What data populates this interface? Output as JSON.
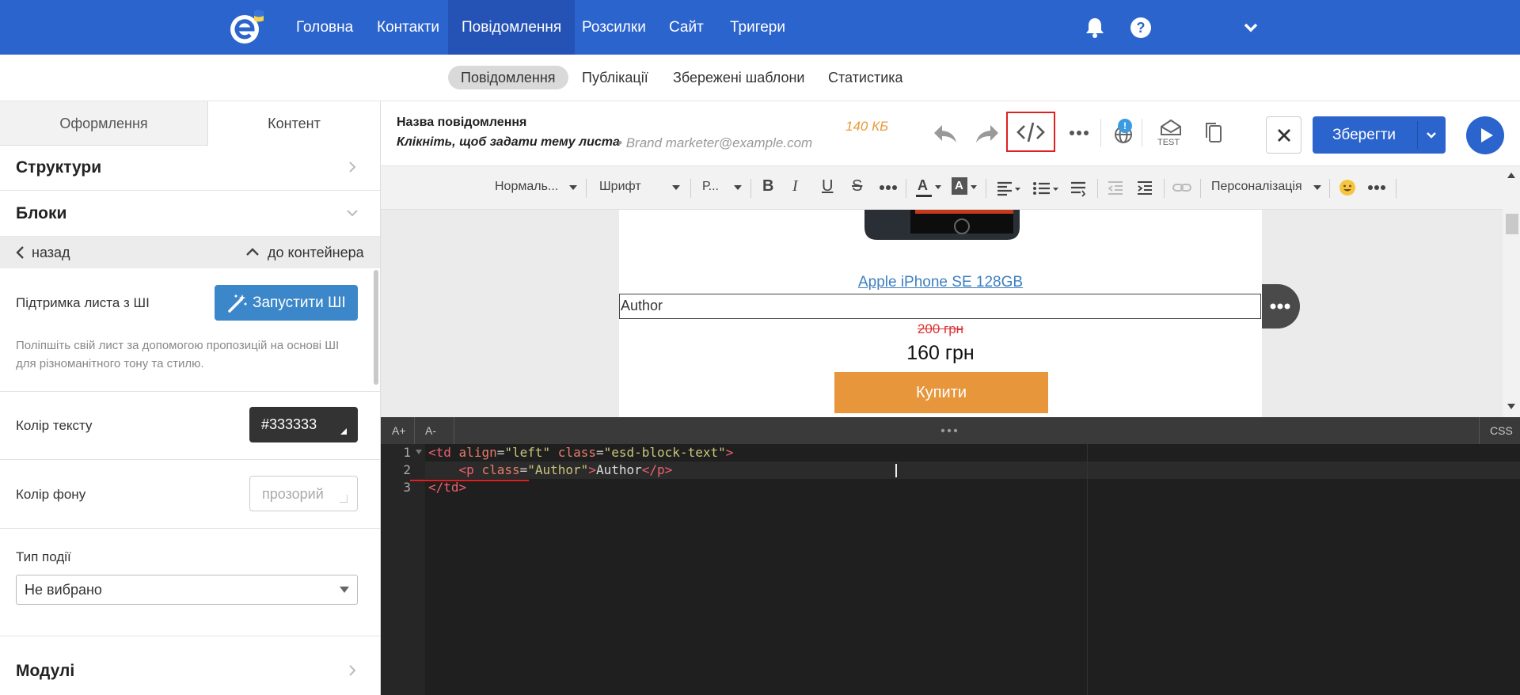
{
  "topnav": {
    "items": [
      "Головна",
      "Контакти",
      "Повідомлення",
      "Розсилки",
      "Сайт",
      "Тригери"
    ],
    "active_index": 2
  },
  "subnav": {
    "items": [
      "Повідомлення",
      "Публікації",
      "Збережені шаблони",
      "Статистика"
    ],
    "active_index": 0
  },
  "leftpanel": {
    "tabs": [
      "Оформлення",
      "Контент"
    ],
    "active_tab": 1,
    "structures_label": "Структури",
    "blocks_label": "Блоки",
    "back_label": "назад",
    "to_container_label": "до контейнера",
    "ai_support_label": "Підтримка листа з ШІ",
    "ai_button_label": "Запустити ШІ",
    "ai_description": "Поліпшіть свій лист за допомогою пропозицій на основі ШІ для різноманітного тону та стилю.",
    "text_color_label": "Колір тексту",
    "text_color_value": "#333333",
    "bg_color_label": "Колір фону",
    "bg_color_value": "прозорий",
    "event_type_label": "Тип події",
    "event_type_value": "Не вибрано",
    "modules_label": "Модулі"
  },
  "editor_header": {
    "message_name": "Назва повідомлення",
    "subject_hint": "Клікніть, щоб задати тему листа",
    "sender": "Brand marketer@example.com",
    "size": "140 КБ",
    "test_label": "TEST",
    "badge_count": "!",
    "save_label": "Зберегти"
  },
  "format_toolbar": {
    "paragraph": "Нормаль...",
    "font": "Шрифт",
    "size": "Р...",
    "personalization": "Персоналізація"
  },
  "email_preview": {
    "product_link": "Apple iPhone SE 128GB",
    "selected_text": "Author",
    "old_price": "200 грн",
    "new_price": "160 грн",
    "buy_button": "Купити"
  },
  "code_editor": {
    "font_increase": "A+",
    "font_decrease": "A-",
    "css_label": "CSS",
    "line_numbers": [
      "1",
      "2",
      "3"
    ],
    "line1": {
      "open": "<td",
      "attr1": "align",
      "val1": "\"left\"",
      "attr2": "class",
      "val2": "\"esd-block-text\"",
      "close": ">"
    },
    "line2": {
      "open": "<p",
      "attr": "class",
      "val": "\"Author\"",
      "close": ">",
      "text": "Author",
      "end": "</p>"
    },
    "line3": {
      "end": "</td>"
    }
  },
  "colors": {
    "brand_blue": "#2c64ce",
    "highlight_red": "#e02020",
    "ai_button": "#3c87c9",
    "buy_button": "#e8963c",
    "size_orange": "#e89a3c"
  }
}
